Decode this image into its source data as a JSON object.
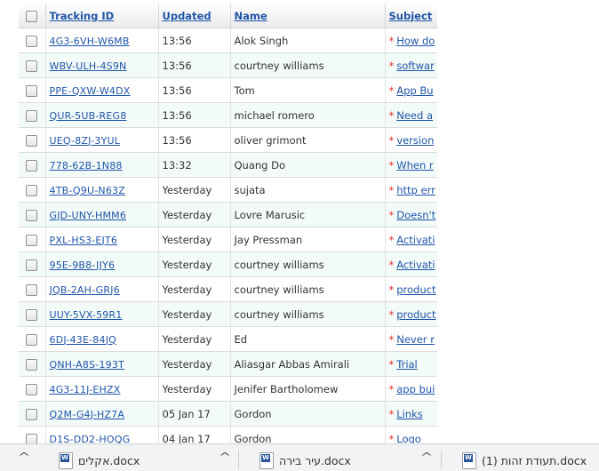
{
  "table": {
    "headers": {
      "tracking_id": "Tracking ID",
      "updated": "Updated",
      "name": "Name",
      "subject": "Subject"
    },
    "rows": [
      {
        "id": "4G3-6VH-W6MB",
        "updated": "13:56",
        "name": "Alok Singh",
        "subject": "How do"
      },
      {
        "id": "WBV-ULH-4S9N",
        "updated": "13:56",
        "name": "courtney williams",
        "subject": "softwar"
      },
      {
        "id": "PPE-QXW-W4DX",
        "updated": "13:56",
        "name": "Tom",
        "subject": "App Bu"
      },
      {
        "id": "QUR-5UB-REG8",
        "updated": "13:56",
        "name": "michael romero",
        "subject": "Need a"
      },
      {
        "id": "UEQ-8ZJ-3YUL",
        "updated": "13:56",
        "name": "oliver grimont",
        "subject": "version"
      },
      {
        "id": "778-62B-1N88",
        "updated": "13:32",
        "name": "Quang Do",
        "subject": "When r"
      },
      {
        "id": "4TB-Q9U-N63Z",
        "updated": "Yesterday",
        "name": "sujata",
        "subject": "http err"
      },
      {
        "id": "GJD-UNY-HMM6",
        "updated": "Yesterday",
        "name": "Lovre Marusic",
        "subject": "Doesn't"
      },
      {
        "id": "PXL-HS3-EJT6",
        "updated": "Yesterday",
        "name": "Jay Pressman",
        "subject": "Activati"
      },
      {
        "id": "95E-9B8-JJY6",
        "updated": "Yesterday",
        "name": "courtney williams",
        "subject": "Activati"
      },
      {
        "id": "JQB-2AH-GRJ6",
        "updated": "Yesterday",
        "name": "courtney williams",
        "subject": "product"
      },
      {
        "id": "UUY-5VX-59R1",
        "updated": "Yesterday",
        "name": "courtney williams",
        "subject": "product"
      },
      {
        "id": "6DJ-43E-84JQ",
        "updated": "Yesterday",
        "name": "Ed",
        "subject": "Never r"
      },
      {
        "id": "QNH-A8S-193T",
        "updated": "Yesterday",
        "name": "Aliasgar Abbas Amirali",
        "subject": "Trial"
      },
      {
        "id": "4G3-11J-EHZX",
        "updated": "Yesterday",
        "name": "Jenifer Bartholomew",
        "subject": "app bui"
      },
      {
        "id": "Q2M-G4J-HZ7A",
        "updated": "05 Jan 17",
        "name": "Gordon",
        "subject": "Links"
      },
      {
        "id": "D1S-DD2-HOQG",
        "updated": "04 Jan 17",
        "name": "Gordon",
        "subject": "Logo"
      }
    ],
    "priority_marker": "*"
  },
  "downloads": {
    "items": [
      {
        "name": "אקלים.docx",
        "icon": "word-document-icon"
      },
      {
        "name": "עיר בירה.docx",
        "icon": "word-document-icon"
      },
      {
        "name": "תעודת זהות (1).docx",
        "icon": "word-document-icon"
      }
    ],
    "chevron_glyph": "^"
  },
  "colors": {
    "link": "#1f55a8",
    "priority_star": "#e03030",
    "row_alt": "#f3fbf8"
  }
}
